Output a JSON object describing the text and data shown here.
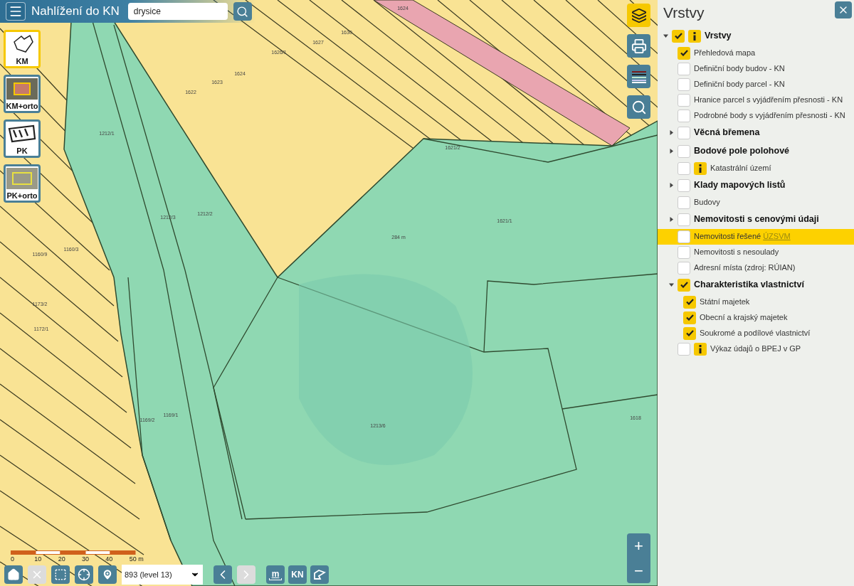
{
  "header": {
    "title": "Nahlížení do KN",
    "search": {
      "value": "drysice"
    }
  },
  "basemaps": [
    {
      "label": "KM",
      "kind": "km",
      "selected": true
    },
    {
      "label": "KM+orto",
      "kind": "orto",
      "selected": false
    },
    {
      "label": "PK",
      "kind": "pk",
      "selected": false
    },
    {
      "label": "PK+orto",
      "kind": "pkorto",
      "selected": false
    }
  ],
  "map_tools": [
    {
      "kind": "layers",
      "selected": true
    },
    {
      "kind": "print",
      "selected": false
    },
    {
      "kind": "legend",
      "selected": false
    },
    {
      "kind": "search",
      "selected": false
    }
  ],
  "map_labels": [
    "1624",
    "1630",
    "1627",
    "1626/1",
    "1624",
    "1623",
    "1622",
    "1212/1",
    "1621/2",
    "1212/2",
    "1212/3",
    "1621/1",
    "284 m",
    "1160/3",
    "1160/9",
    "1173/2",
    "1172/1",
    "1169/1",
    "1618",
    "1169/2",
    "1213/6"
  ],
  "scale": {
    "ticks": [
      "0",
      "10",
      "20",
      "30",
      "40",
      "50 m"
    ]
  },
  "zoom": {
    "in": "+",
    "out": "−"
  },
  "bottom_bar": {
    "tools": [
      {
        "kind": "home",
        "disabled": false
      },
      {
        "kind": "clear",
        "disabled": true
      },
      {
        "kind": "select-area",
        "disabled": false
      },
      {
        "kind": "locate",
        "disabled": false
      },
      {
        "kind": "marker",
        "disabled": false
      }
    ],
    "level": "893 (level 13)",
    "nav": [
      {
        "kind": "prev",
        "disabled": false
      },
      {
        "kind": "next",
        "disabled": true
      }
    ],
    "extra": [
      {
        "kind": "measure",
        "label": "m"
      },
      {
        "kind": "text",
        "label": "KN"
      },
      {
        "kind": "shape"
      }
    ]
  },
  "panel": {
    "title": "Vrstvy",
    "layers": [
      {
        "kind": "group",
        "label": "Vrstvy",
        "checked": true,
        "info": true,
        "expanded": true,
        "selected": false,
        "children": [
          {
            "kind": "layer",
            "label": "Přehledová mapa",
            "checked": true,
            "info": false,
            "selected": false
          },
          {
            "kind": "layer",
            "label": "Definiční body budov - KN",
            "checked": false,
            "info": false,
            "selected": false
          },
          {
            "kind": "layer",
            "label": "Definiční body parcel - KN",
            "checked": false,
            "info": false,
            "selected": false
          },
          {
            "kind": "layer",
            "label": "Hranice parcel s vyjádřením přesnosti - KN",
            "checked": false,
            "info": false,
            "selected": false
          },
          {
            "kind": "layer",
            "label": "Podrobné body s vyjádřením přesnosti - KN",
            "checked": false,
            "info": false,
            "selected": false
          },
          {
            "kind": "group",
            "label": "Věcná břemena",
            "checked": false,
            "info": false,
            "expanded": false,
            "selected": false
          },
          {
            "kind": "group",
            "label": "Bodové pole polohové",
            "checked": false,
            "info": false,
            "expanded": false,
            "selected": false
          },
          {
            "kind": "layer",
            "label": "Katastrální území",
            "checked": false,
            "info": true,
            "selected": false
          },
          {
            "kind": "group",
            "label": "Klady mapových listů",
            "checked": false,
            "info": false,
            "expanded": false,
            "selected": false
          },
          {
            "kind": "layer",
            "label": "Budovy",
            "checked": false,
            "info": false,
            "selected": false
          },
          {
            "kind": "group",
            "label": "Nemovitosti s cenovými údaji",
            "checked": false,
            "info": false,
            "expanded": false,
            "selected": false
          },
          {
            "kind": "layer",
            "label": "Nemovitosti řešené",
            "link": "ÚZSVM",
            "checked": false,
            "info": false,
            "selected": true
          },
          {
            "kind": "layer",
            "label": "Nemovitosti s nesoulady",
            "checked": false,
            "info": false,
            "selected": false
          },
          {
            "kind": "layer",
            "label": "Adresní místa (zdroj: RÚIAN)",
            "checked": false,
            "info": false,
            "selected": false
          },
          {
            "kind": "group",
            "label": "Charakteristika vlastnictví",
            "checked": true,
            "info": false,
            "expanded": true,
            "selected": false,
            "children": [
              {
                "kind": "layer",
                "label": "Státní majetek",
                "checked": true,
                "info": false,
                "selected": false
              },
              {
                "kind": "layer",
                "label": "Obecní a krajský majetek",
                "checked": true,
                "info": false,
                "selected": false
              },
              {
                "kind": "layer",
                "label": "Soukromé a podílové vlastnictví",
                "checked": true,
                "info": false,
                "selected": false
              }
            ]
          },
          {
            "kind": "layer",
            "label": "Výkaz údajů o BPEJ v GP",
            "checked": false,
            "info": true,
            "selected": false
          }
        ]
      }
    ]
  }
}
